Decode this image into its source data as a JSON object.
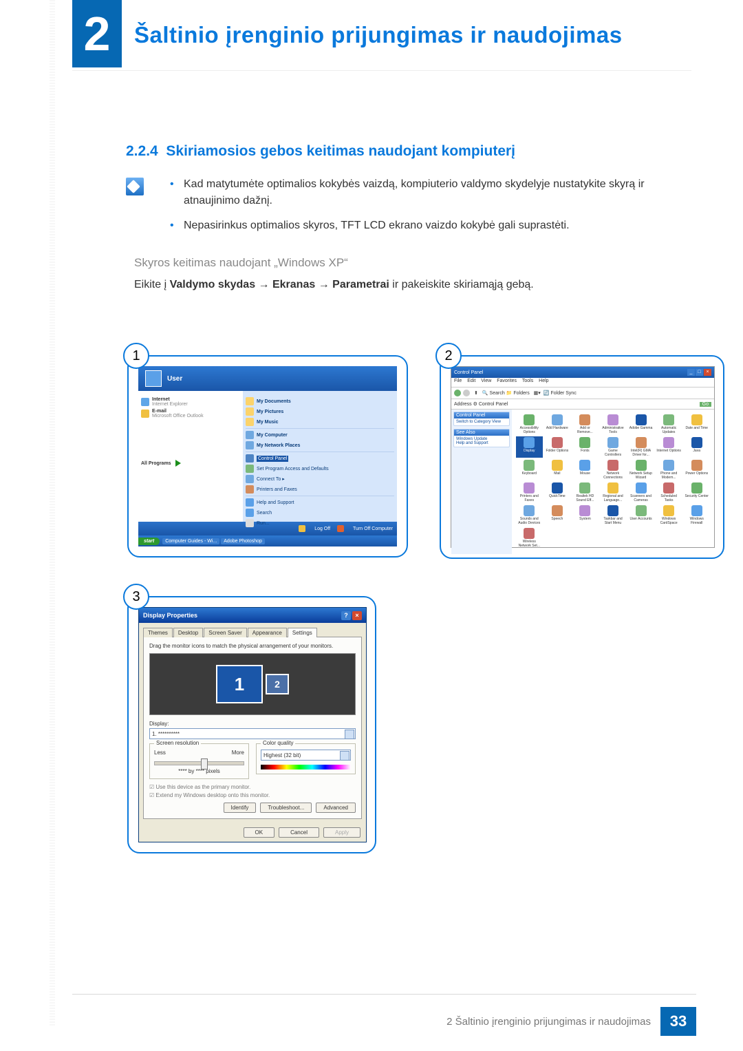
{
  "chapter": {
    "number": "2",
    "title": "Šaltinio įrenginio prijungimas ir naudojimas"
  },
  "section": {
    "number": "2.2.4",
    "title": "Skiriamosios gebos keitimas naudojant kompiuterį"
  },
  "notes": {
    "b1": "Kad matytumėte optimalios kokybės vaizdą, kompiuterio valdymo skydelyje nustatykite skyrą ir atnaujinimo dažnį.",
    "b2": "Nepasirinkus optimalios skyros, TFT LCD ekrano vaizdo kokybė gali suprastėti."
  },
  "subheading": "Skyros keitimas naudojant „Windows XP“",
  "path": {
    "pre": "Eikite į ",
    "p1": "Valdymo skydas",
    "arrow": " → ",
    "p2": "Ekranas",
    "p3": "Parametrai",
    "post": " ir pakeiskite skiriamąją gebą."
  },
  "badges": {
    "b1": "1",
    "b2": "2",
    "b3": "3"
  },
  "fig1": {
    "user": "User",
    "left": {
      "internet_t": "Internet",
      "internet_s": "Internet Explorer",
      "email_t": "E-mail",
      "email_s": "Microsoft Office Outlook",
      "all_programs": "All Programs"
    },
    "right": {
      "mydocs": "My Documents",
      "mypics": "My Pictures",
      "mymusic": "My Music",
      "mycomp": "My Computer",
      "mynet": "My Network Places",
      "cpanel": "Control Panel",
      "setprog": "Set Program Access and Defaults",
      "connect": "Connect To",
      "printers": "Printers and Faxes",
      "help": "Help and Support",
      "search": "Search",
      "run": "Run..."
    },
    "logoff": "Log Off",
    "turnoff": "Turn Off Computer",
    "taskbar": {
      "start": "start",
      "t1": "Computer Guides - Wi...",
      "t2": "Adobe Photoshop"
    }
  },
  "fig2": {
    "title": "Control Panel",
    "menubar": {
      "file": "File",
      "edit": "Edit",
      "view": "View",
      "fav": "Favorites",
      "tools": "Tools",
      "help": "Help"
    },
    "toolbar": {
      "search": "Search",
      "folders": "Folders",
      "sync": "Folder Sync"
    },
    "address_label": "Address",
    "address_val": "Control Panel",
    "go": "Go",
    "side": {
      "panel1_t": "Control Panel",
      "panel1_i": "Switch to Category View",
      "panel2_t": "See Also",
      "panel2_i1": "Windows Update",
      "panel2_i2": "Help and Support"
    },
    "items": [
      "Accessibility Options",
      "Add Hardware",
      "Add or Remove...",
      "Administrative Tools",
      "Adobe Gamma",
      "Automatic Updates",
      "Date and Time",
      "Display",
      "Folder Options",
      "Fonts",
      "Game Controllers",
      "Intel(R) GMA Driver for...",
      "Internet Options",
      "Java",
      "Keyboard",
      "Mail",
      "Mouse",
      "Network Connections",
      "Network Setup Wizard",
      "Phone and Modem...",
      "Power Options",
      "Printers and Faxes",
      "QuickTime",
      "Realtek HD Sound Eff...",
      "Regional and Language...",
      "Scanners and Cameras",
      "Scheduled Tasks",
      "Security Center",
      "Sounds and Audio Devices",
      "Speech",
      "System",
      "Taskbar and Start Menu",
      "User Accounts",
      "Windows CardSpace",
      "Windows Firewall",
      "Wireless Network Set..."
    ],
    "selected_index": 7
  },
  "fig3": {
    "title": "Display Properties",
    "tabs": {
      "themes": "Themes",
      "desktop": "Desktop",
      "saver": "Screen Saver",
      "appearance": "Appearance",
      "settings": "Settings"
    },
    "hint": "Drag the monitor icons to match the physical arrangement of your monitors.",
    "mon1": "1",
    "mon2": "2",
    "display_label": "Display:",
    "display_value": "1. **********",
    "grp_res": "Screen resolution",
    "less": "Less",
    "more": "More",
    "res_value": "**** by **** pixels",
    "grp_color": "Color quality",
    "color_value": "Highest (32 bit)",
    "chk1": "Use this device as the primary monitor.",
    "chk2": "Extend my Windows desktop onto this monitor.",
    "btn_identify": "Identify",
    "btn_trouble": "Troubleshoot...",
    "btn_adv": "Advanced",
    "btn_ok": "OK",
    "btn_cancel": "Cancel",
    "btn_apply": "Apply"
  },
  "footer": {
    "text": "2 Šaltinio įrenginio prijungimas ir naudojimas",
    "page": "33"
  }
}
